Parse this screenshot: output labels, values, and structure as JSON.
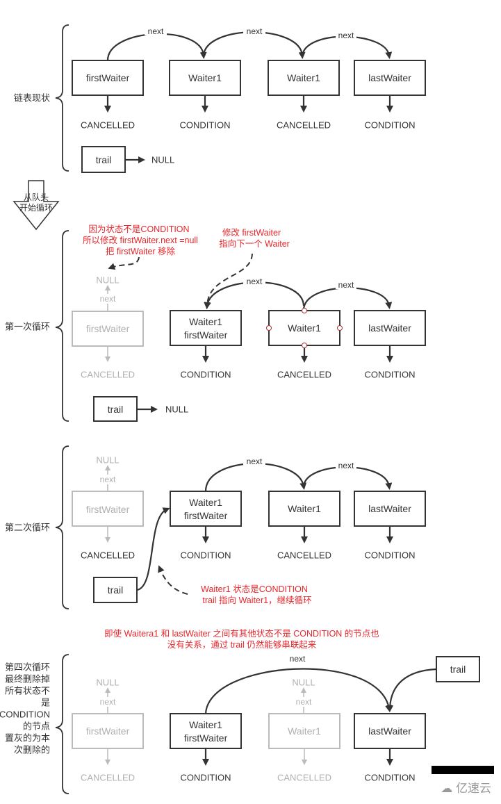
{
  "sections": [
    {
      "label": "链表现状",
      "nodes": [
        {
          "text": [
            "firstWaiter"
          ],
          "status": "CANCELLED",
          "gray": false
        },
        {
          "text": [
            "Waiter1"
          ],
          "status": "CONDITION",
          "gray": false
        },
        {
          "text": [
            "Waiter1"
          ],
          "status": "CANCELLED",
          "gray": false
        },
        {
          "text": [
            "lastWaiter"
          ],
          "status": "CONDITION",
          "gray": false
        }
      ],
      "edge_label": "next",
      "trail": {
        "label": "trail",
        "target": "NULL"
      }
    },
    {
      "label": "第一次循环",
      "nodes": [
        {
          "text": [
            "firstWaiter"
          ],
          "status": "CANCELLED",
          "gray": true
        },
        {
          "text": [
            "Waiter1",
            "firstWaiter"
          ],
          "status": "CONDITION",
          "gray": false
        },
        {
          "text": [
            "Waiter1"
          ],
          "status": "CANCELLED",
          "gray": false
        },
        {
          "text": [
            "lastWaiter"
          ],
          "status": "CONDITION",
          "gray": false
        }
      ],
      "edge_label": "next",
      "null_label": "NULL",
      "trail": {
        "label": "trail",
        "target": "NULL"
      },
      "notes": [
        [
          "因为状态不是CONDITION",
          "所以修改 firstWaiter.next =null",
          "把 firstWaiter 移除"
        ],
        [
          "修改 firstWaiter",
          "指向下一个 Waiter"
        ]
      ]
    },
    {
      "label": "第二次循环",
      "nodes": [
        {
          "text": [
            "firstWaiter"
          ],
          "status": "CANCELLED",
          "gray": true
        },
        {
          "text": [
            "Waiter1",
            "firstWaiter"
          ],
          "status": "CONDITION",
          "gray": false
        },
        {
          "text": [
            "Waiter1"
          ],
          "status": "CANCELLED",
          "gray": false
        },
        {
          "text": [
            "lastWaiter"
          ],
          "status": "CONDITION",
          "gray": false
        }
      ],
      "edge_label": "next",
      "null_label": "NULL",
      "trail": {
        "label": "trail"
      },
      "notes": [
        [
          "Waiter1 状态是CONDITION",
          "trail 指向 Waiter1，继续循环"
        ]
      ]
    },
    {
      "label": [
        "第四次循环",
        "最终删除掉",
        "所有状态不",
        "是",
        "CONDITION",
        "的节点",
        "置灰的为本",
        "次删除的"
      ],
      "nodes": [
        {
          "text": [
            "firstWaiter"
          ],
          "status": "CANCELLED",
          "gray": true
        },
        {
          "text": [
            "Waiter1",
            "firstWaiter"
          ],
          "status": "CONDITION",
          "gray": false
        },
        {
          "text": [
            "Waiter1"
          ],
          "status": "CANCELLED",
          "gray": true
        },
        {
          "text": [
            "lastWaiter"
          ],
          "status": "CONDITION",
          "gray": false
        }
      ],
      "edge_label": "next",
      "null_label": "NULL",
      "trail": {
        "label": "trail"
      },
      "notes": [
        [
          "即使 Waitera1 和 lastWaiter 之间有其他状态不是 CONDITION 的节点也",
          "没有关系，通过 trail 仍然能够串联起来"
        ]
      ]
    }
  ],
  "loop_arrow_label": [
    "从队头",
    "开始循环"
  ],
  "watermark": "亿速云",
  "colors": {
    "accent_red": "#e8262b",
    "gray": "#bbbbbb",
    "ink": "#333333"
  }
}
